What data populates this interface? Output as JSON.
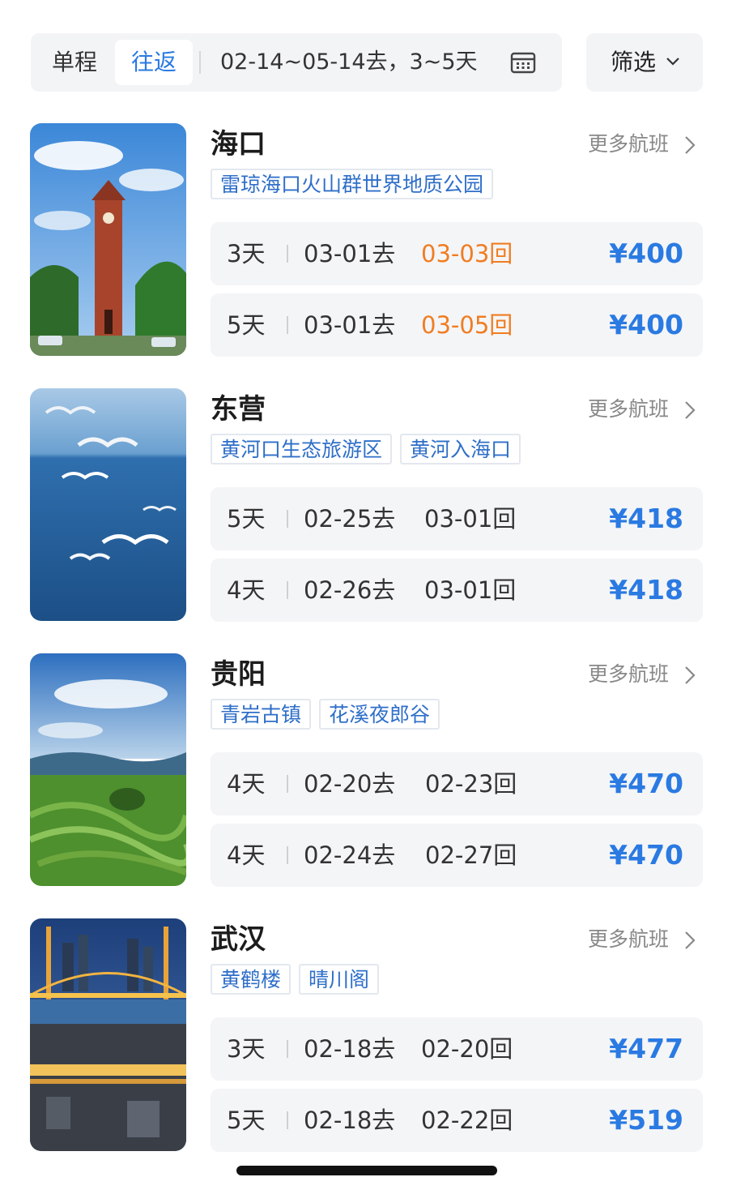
{
  "topbar": {
    "one_way": "单程",
    "round_trip": "往返",
    "date_range": "02-14~05-14去，3~5天",
    "filter": "筛选",
    "calendar_icon": "calendar-icon",
    "filter_icon": "chevron-down-icon"
  },
  "accent": "#2a7ae2",
  "highlight": "#f07d22",
  "destinations": [
    {
      "city": "海口",
      "more": "更多航班",
      "tags": [
        "雷琼海口火山群世界地质公园"
      ],
      "flights": [
        {
          "days": "3天",
          "depart": "03-01去",
          "return": "03-03回",
          "price": "¥400",
          "highlight": true
        },
        {
          "days": "5天",
          "depart": "03-01去",
          "return": "03-05回",
          "price": "¥400",
          "highlight": true
        }
      ]
    },
    {
      "city": "东营",
      "more": "更多航班",
      "tags": [
        "黄河口生态旅游区",
        "黄河入海口"
      ],
      "flights": [
        {
          "days": "5天",
          "depart": "02-25去",
          "return": "03-01回",
          "price": "¥418",
          "highlight": false
        },
        {
          "days": "4天",
          "depart": "02-26去",
          "return": "03-01回",
          "price": "¥418",
          "highlight": false
        }
      ]
    },
    {
      "city": "贵阳",
      "more": "更多航班",
      "tags": [
        "青岩古镇",
        "花溪夜郎谷"
      ],
      "flights": [
        {
          "days": "4天",
          "depart": "02-20去",
          "return": "02-23回",
          "price": "¥470",
          "highlight": false
        },
        {
          "days": "4天",
          "depart": "02-24去",
          "return": "02-27回",
          "price": "¥470",
          "highlight": false
        }
      ]
    },
    {
      "city": "武汉",
      "more": "更多航班",
      "tags": [
        "黄鹤楼",
        "晴川阁"
      ],
      "flights": [
        {
          "days": "3天",
          "depart": "02-18去",
          "return": "02-20回",
          "price": "¥477",
          "highlight": false
        },
        {
          "days": "5天",
          "depart": "02-18去",
          "return": "02-22回",
          "price": "¥519",
          "highlight": false
        }
      ]
    }
  ]
}
